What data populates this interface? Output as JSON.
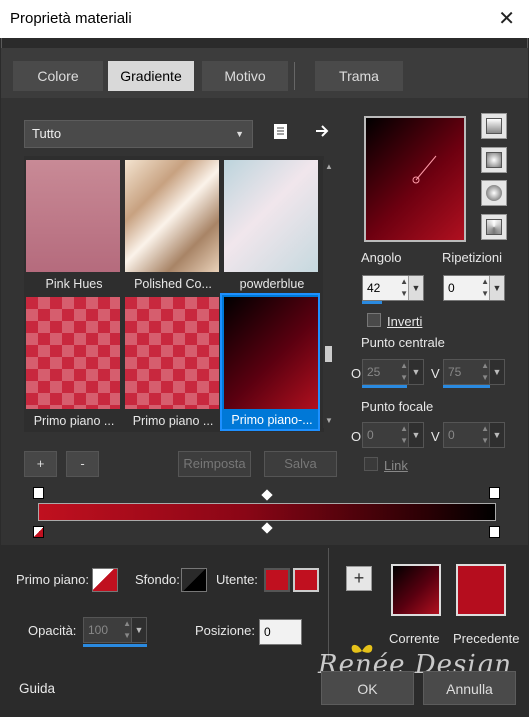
{
  "window": {
    "title": "Proprietà materiali"
  },
  "tabs": [
    "Colore",
    "Gradiente",
    "Motivo",
    "Trama"
  ],
  "filter": {
    "selected": "Tutto"
  },
  "gradients": [
    {
      "label": "Pink Hues"
    },
    {
      "label": "Polished Co..."
    },
    {
      "label": "powderblue"
    },
    {
      "label": "Primo piano ..."
    },
    {
      "label": "Primo piano ..."
    },
    {
      "label": "Primo piano-..."
    }
  ],
  "list_buttons": {
    "add": "+",
    "remove": "-",
    "reset": "Reimposta",
    "save": "Salva"
  },
  "angle": {
    "label": "Angolo",
    "value": "42"
  },
  "repeats": {
    "label": "Ripetizioni",
    "value": "0"
  },
  "invert": {
    "label": "Inverti"
  },
  "center": {
    "label": "Punto centrale",
    "o_label": "O",
    "o_value": "25",
    "v_label": "V",
    "v_value": "75"
  },
  "focal": {
    "label": "Punto focale",
    "o_label": "O",
    "o_value": "0",
    "v_label": "V",
    "v_value": "0"
  },
  "link": {
    "label": "Link"
  },
  "bottom": {
    "foreground_label": "Primo piano:",
    "background_label": "Sfondo:",
    "user_label": "Utente:",
    "opacity_label": "Opacità:",
    "opacity_value": "100",
    "position_label": "Posizione:",
    "position_value": "0",
    "current_label": "Corrente",
    "previous_label": "Precedente",
    "add_symbol": "+"
  },
  "footer": {
    "help": "Guida",
    "ok": "OK",
    "cancel": "Annulla",
    "watermark": "Renée Design"
  },
  "colors": {
    "accent": "#0078d7",
    "user_color": "#c0101f",
    "previous": "#b50d1e"
  }
}
